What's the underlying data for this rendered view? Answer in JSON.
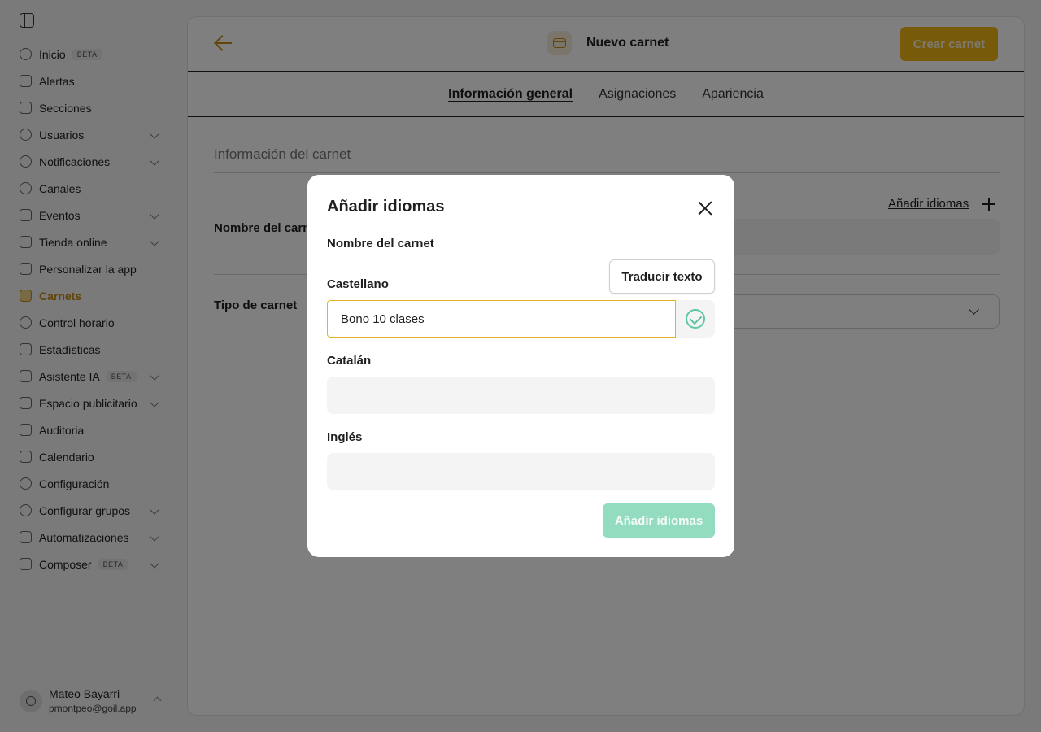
{
  "sidebar": {
    "items": [
      {
        "label": "Inicio",
        "badge": "BETA",
        "icon": "home-icon"
      },
      {
        "label": "Alertas",
        "icon": "bell-icon"
      },
      {
        "label": "Secciones",
        "icon": "sections-icon"
      },
      {
        "label": "Usuarios",
        "icon": "users-icon",
        "expandable": true
      },
      {
        "label": "Notificaciones",
        "icon": "notifications-icon",
        "expandable": true
      },
      {
        "label": "Canales",
        "icon": "channels-icon"
      },
      {
        "label": "Eventos",
        "icon": "events-icon",
        "expandable": true
      },
      {
        "label": "Tienda online",
        "icon": "store-icon",
        "expandable": true
      },
      {
        "label": "Personalizar la app",
        "icon": "customize-icon"
      },
      {
        "label": "Carnets",
        "icon": "card-icon",
        "active": true
      },
      {
        "label": "Control horario",
        "icon": "clock-icon"
      },
      {
        "label": "Estadísticas",
        "icon": "stats-icon"
      },
      {
        "label": "Asistente IA",
        "badge": "BETA",
        "icon": "ai-icon",
        "expandable": true
      },
      {
        "label": "Espacio publicitario",
        "icon": "ad-icon",
        "expandable": true
      },
      {
        "label": "Auditoria",
        "icon": "audit-icon"
      },
      {
        "label": "Calendario",
        "icon": "calendar-icon"
      },
      {
        "label": "Configuración",
        "icon": "settings-icon"
      },
      {
        "label": "Configurar grupos",
        "icon": "groups-icon",
        "expandable": true
      },
      {
        "label": "Automatizaciones",
        "icon": "automation-icon",
        "expandable": true
      },
      {
        "label": "Composer",
        "badge": "BETA",
        "icon": "composer-icon",
        "expandable": true
      }
    ],
    "user": {
      "name": "Mateo Bayarri",
      "email": "pmontpeo@goil.app"
    }
  },
  "header": {
    "title": "Nuevo carnet",
    "create_label": "Crear carnet",
    "accent_color": "#f0b417"
  },
  "tabs": [
    {
      "label": "Información general",
      "active": true
    },
    {
      "label": "Asignaciones"
    },
    {
      "label": "Apariencia"
    }
  ],
  "form": {
    "section_title": "Información del carnet",
    "add_languages_link": "Añadir idiomas",
    "name_label": "Nombre del carnet",
    "type_label": "Tipo de carnet"
  },
  "modal": {
    "title": "Añadir idiomas",
    "subtitle": "Nombre del carnet",
    "translate_label": "Traducir texto",
    "languages": [
      {
        "label": "Castellano",
        "value": "Bono 10 clases"
      },
      {
        "label": "Catalán",
        "value": ""
      },
      {
        "label": "Inglés",
        "value": ""
      }
    ],
    "submit_label": "Añadir idiomas",
    "success_color": "#5fc6a3"
  }
}
